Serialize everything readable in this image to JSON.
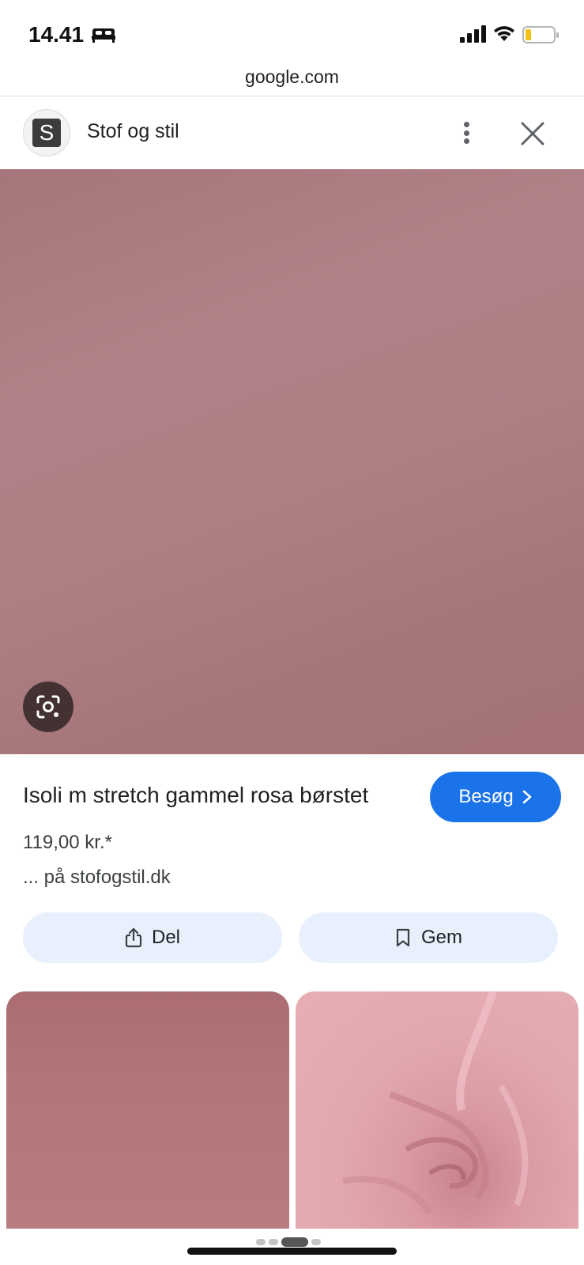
{
  "status_bar": {
    "time": "14.41",
    "icons": [
      "bed-icon",
      "signal-icon",
      "wifi-icon",
      "battery-icon"
    ],
    "battery_color": "#f4c20d"
  },
  "url_bar": {
    "domain": "google.com"
  },
  "site_header": {
    "avatar_letter": "S",
    "site_name": "Stof og stil",
    "icons": [
      "more-icon",
      "close-icon"
    ]
  },
  "main_image": {
    "description_icon": "lens-icon",
    "colors": [
      "#a67579",
      "#b08186"
    ]
  },
  "product": {
    "title": "Isoli m stretch gammel rosa børstet",
    "visit_label": "Besøg",
    "price": "119,00 kr.*",
    "source": "... på stofogstil.dk",
    "share_label": "Del",
    "save_label": "Gem"
  },
  "accent": {
    "primary_button": "#1a73e8",
    "secondary_button": "#e8f0fe"
  },
  "related_images": [
    {
      "color": "#b1767a"
    },
    {
      "color": "#e2a8b0"
    }
  ]
}
